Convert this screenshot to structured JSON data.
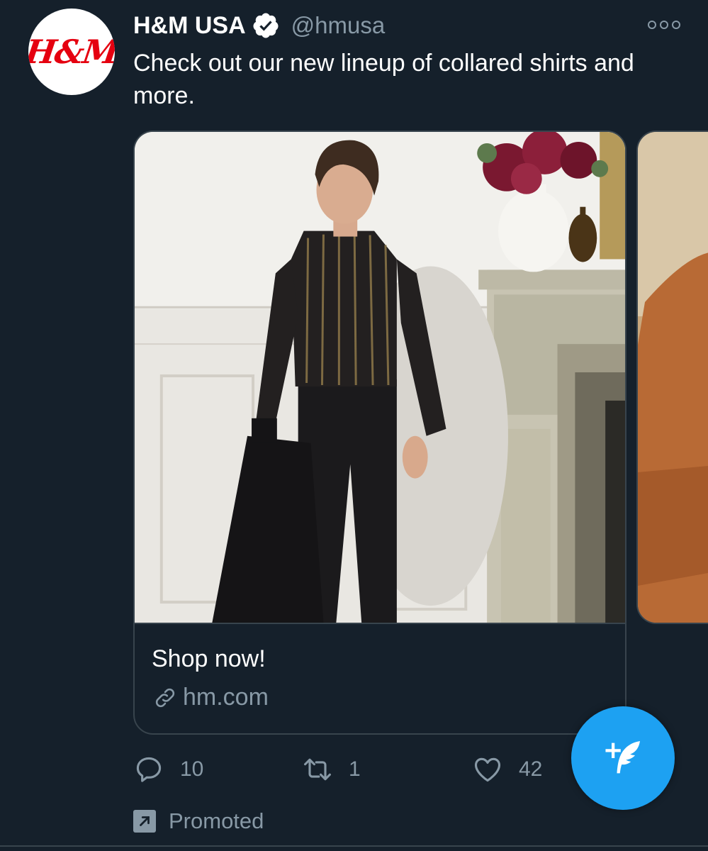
{
  "tweet": {
    "author": {
      "display_name": "H&M USA",
      "handle": "@hmusa",
      "avatar_text": "H&M",
      "verified": true
    },
    "text": "Check out our new lineup of collared shirts and more.",
    "card": {
      "title": "Shop now!",
      "domain": "hm.com"
    },
    "actions": {
      "reply_count": "10",
      "retweet_count": "1",
      "like_count": "42"
    },
    "promoted_label": "Promoted"
  },
  "icons": {
    "verified": "verified-badge-icon",
    "more": "more-options-icon",
    "link": "link-icon",
    "reply": "reply-icon",
    "retweet": "retweet-icon",
    "like": "heart-icon",
    "promoted": "promoted-arrow-icon",
    "compose": "compose-tweet-icon"
  },
  "colors": {
    "background": "#15202b",
    "secondary_text": "#8899a6",
    "border": "#38444d",
    "accent": "#1da1f2",
    "brand_red": "#e50010"
  }
}
